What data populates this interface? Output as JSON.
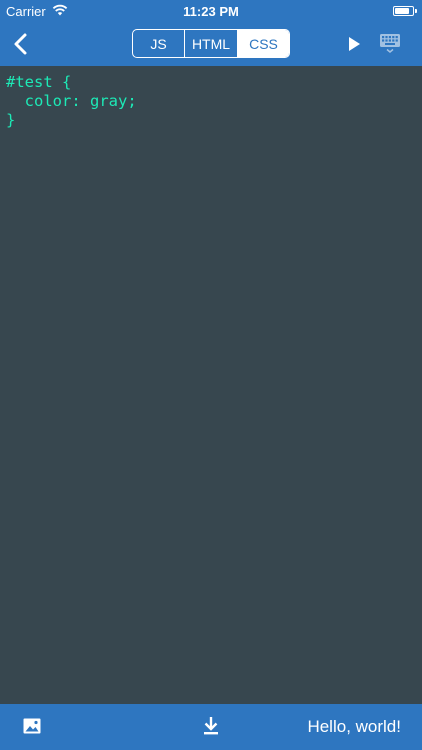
{
  "status_bar": {
    "carrier": "Carrier",
    "time": "11:23 PM",
    "battery_level": 0.9
  },
  "nav": {
    "back_icon": "chevron-left-icon",
    "tabs": [
      {
        "label": "JS",
        "selected": false
      },
      {
        "label": "HTML",
        "selected": false
      },
      {
        "label": "CSS",
        "selected": true
      }
    ],
    "play_icon": "play-icon",
    "keyboard_icon": "keyboard-icon"
  },
  "editor": {
    "lines": [
      "#test {",
      "  color: gray;",
      "}"
    ]
  },
  "bottom_bar": {
    "image_icon": "image-icon",
    "download_icon": "download-icon",
    "output_text": "Hello, world!"
  },
  "colors": {
    "accent": "#2e76c0",
    "editor_bg": "#37474f",
    "code_text": "#1de9b6"
  }
}
